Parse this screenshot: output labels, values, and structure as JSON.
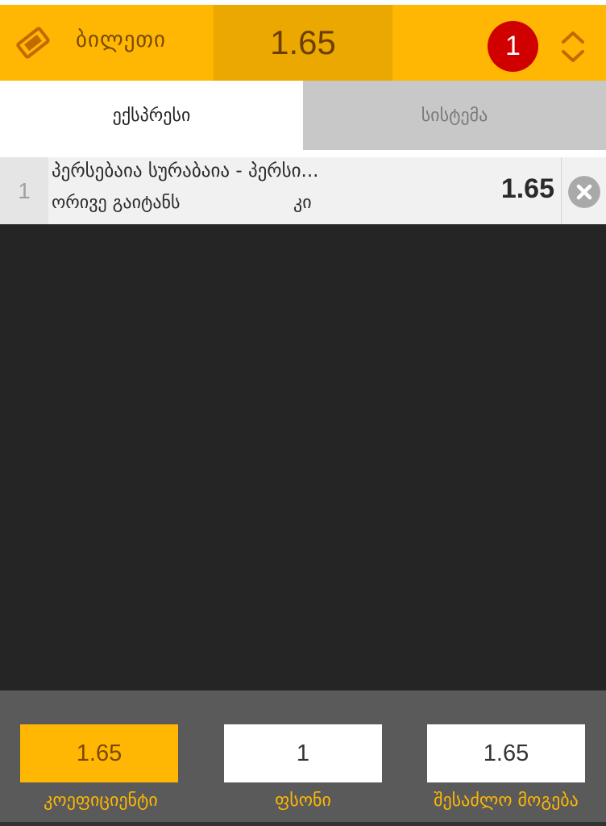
{
  "header": {
    "ticket_icon": "ticket-icon",
    "ticket_label": "ბილეთი",
    "total_odds": "1.65",
    "bet_count": "1",
    "toggle_icon": "chevron-up-down-icon",
    "colors": {
      "accent": "#FFB703",
      "accent_dark": "#EAA800",
      "badge": "#D00000"
    }
  },
  "tabs": [
    {
      "label": "ექსპრესი",
      "active": true
    },
    {
      "label": "სისტემა",
      "active": false
    }
  ],
  "bets": [
    {
      "index": "1",
      "event": "პერსებაია სურაბაია - პერსი...",
      "market": "ორივე გაიტანს",
      "selection": "კი",
      "odds": "1.65",
      "remove_icon": "close-circle-icon"
    }
  ],
  "footer": {
    "coefficient": {
      "value": "1.65",
      "label": "კოეფიციენტი"
    },
    "stake": {
      "value": "1",
      "label": "ფსონი"
    },
    "possible_win": {
      "value": "1.65",
      "label": "შესაძლო მოგება"
    }
  }
}
